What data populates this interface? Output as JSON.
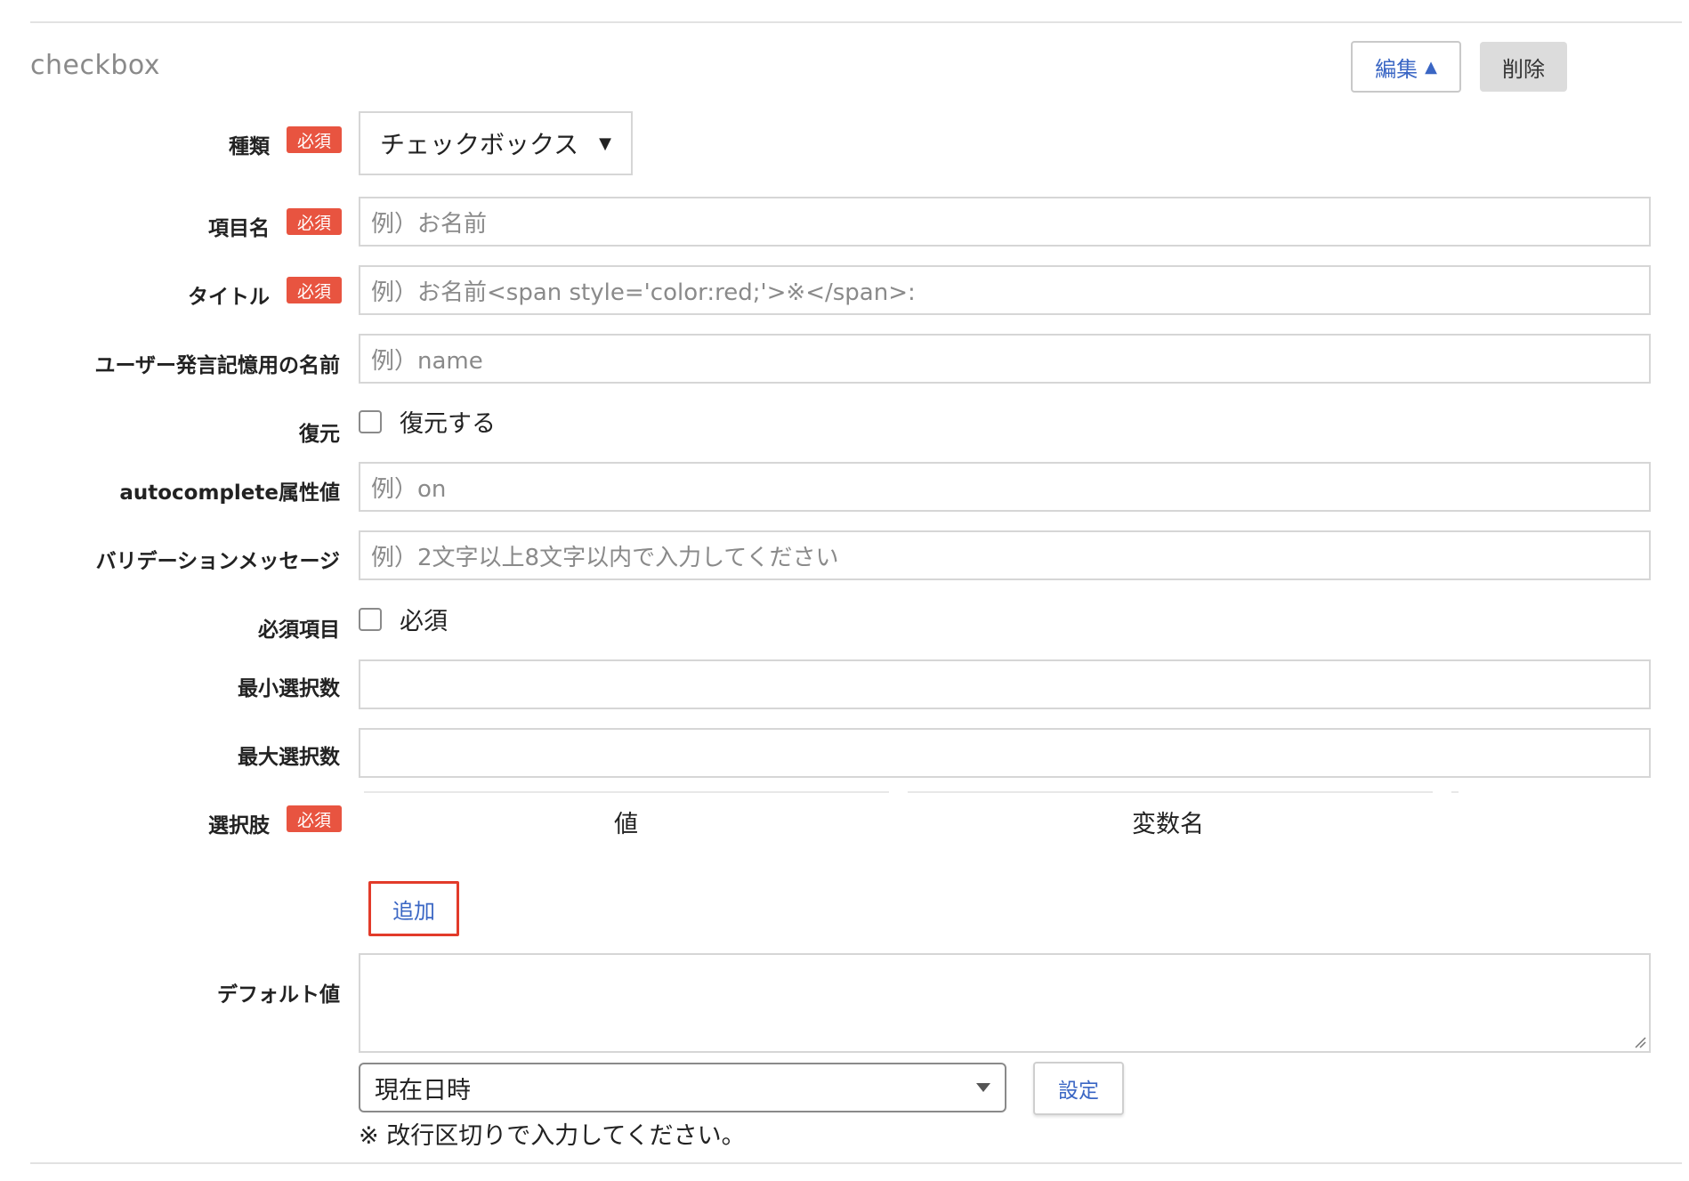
{
  "section": {
    "title": "checkbox",
    "edit_label": "編集",
    "edit_caret": "▲",
    "delete_label": "削除"
  },
  "required_badge": "必須",
  "fields": {
    "type": {
      "label": "種類",
      "value": "チェックボックス",
      "arrow": "▼"
    },
    "item_name": {
      "label": "項目名",
      "placeholder": "例）お名前"
    },
    "title": {
      "label": "タイトル",
      "placeholder": "例）お名前<span style='color:red;'>※</span>:"
    },
    "memory_name": {
      "label": "ユーザー発言記憶用の名前",
      "placeholder": "例）name"
    },
    "restore": {
      "label": "復元",
      "checkbox_label": "復元する",
      "checked": false
    },
    "autocomplete": {
      "label": "autocomplete属性値",
      "placeholder": "例）on"
    },
    "validation": {
      "label": "バリデーションメッセージ",
      "placeholder": "例）2文字以上8文字以内で入力してください"
    },
    "required": {
      "label": "必須項目",
      "checkbox_label": "必須",
      "checked": false
    },
    "min_select": {
      "label": "最小選択数",
      "value": ""
    },
    "max_select": {
      "label": "最大選択数",
      "value": ""
    },
    "options": {
      "label": "選択肢",
      "columns": [
        "値",
        "変数名"
      ],
      "add_label": "追加"
    },
    "default": {
      "label": "デフォルト値",
      "value": "",
      "select_value": "現在日時",
      "set_label": "設定",
      "hint": "※ 改行区切りで入力してください。"
    }
  },
  "colors": {
    "accent": "#3a66c4",
    "badge": "#e85440",
    "highlight": "#e23b2a"
  }
}
